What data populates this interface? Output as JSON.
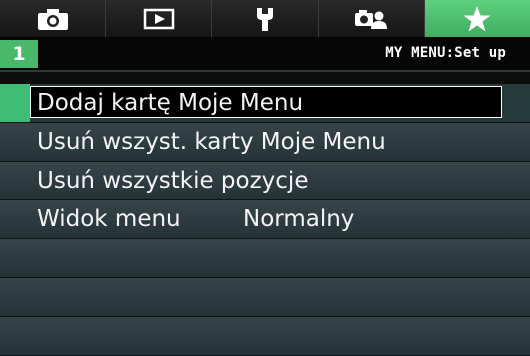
{
  "tabs": [
    {
      "icon": "camera-icon"
    },
    {
      "icon": "playback-icon"
    },
    {
      "icon": "wrench-icon"
    },
    {
      "icon": "custom-functions-icon"
    },
    {
      "icon": "star-icon",
      "active": true
    }
  ],
  "header": {
    "tab_number": "1",
    "title": "MY MENU:Set up"
  },
  "menu": {
    "items": [
      {
        "label": "Dodaj kartę Moje Menu"
      },
      {
        "label": "Usuń wszyst. karty Moje Menu"
      },
      {
        "label": "Usuń wszystkie pozycje"
      },
      {
        "label": "Widok menu",
        "value": "Normalny"
      }
    ]
  },
  "colors": {
    "accent": "#49b86a",
    "row_background": "#2e3c41",
    "text": "#f4f4f4"
  }
}
